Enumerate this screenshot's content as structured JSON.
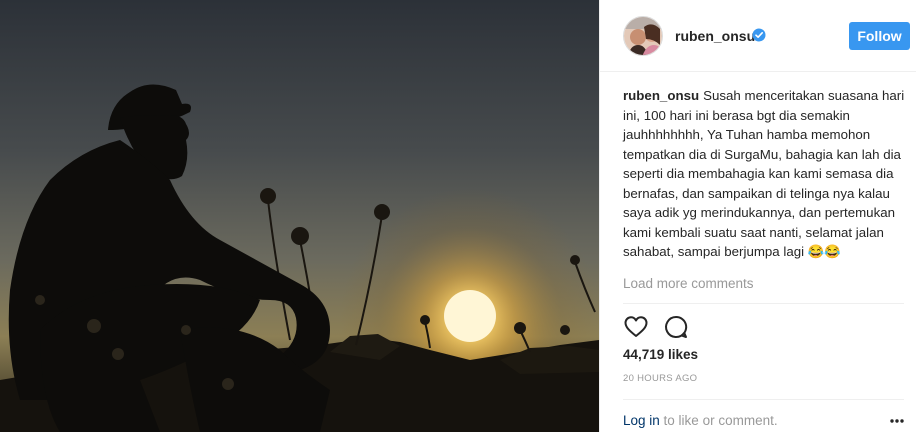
{
  "post": {
    "image_alt": "silhouette-sunset-photo"
  },
  "header": {
    "username": "ruben_onsu",
    "follow_label": "Follow",
    "verified_icon": "verified-badge-icon"
  },
  "caption": {
    "username": "ruben_onsu",
    "text": "Susah menceritakan suasana hari ini, 100 hari ini berasa bgt dia semakin jauhhhhhhhh, Ya Tuhan hamba memohon tempatkan dia di SurgaMu, bahagia kan lah dia seperti dia membahagia kan kami semasa dia bernafas, dan sampaikan di telinga nya kalau saya adik yg merindukannya, dan pertemukan kami kembali suatu saat nanti, selamat jalan sahabat, sampai berjumpa lagi 😂😂"
  },
  "comments": {
    "load_more_label": "Load more comments"
  },
  "actions": {
    "like_icon": "heart-icon",
    "comment_icon": "comment-icon",
    "likes_text": "44,719 likes",
    "timestamp": "20 HOURS AGO"
  },
  "footer": {
    "login_label": "Log in",
    "login_suffix": " to like or comment.",
    "more_icon": "more-options-icon"
  },
  "colors": {
    "follow_button": "#3897f0",
    "secondary_text": "#999999",
    "link": "#003569",
    "divider": "#efefef"
  }
}
